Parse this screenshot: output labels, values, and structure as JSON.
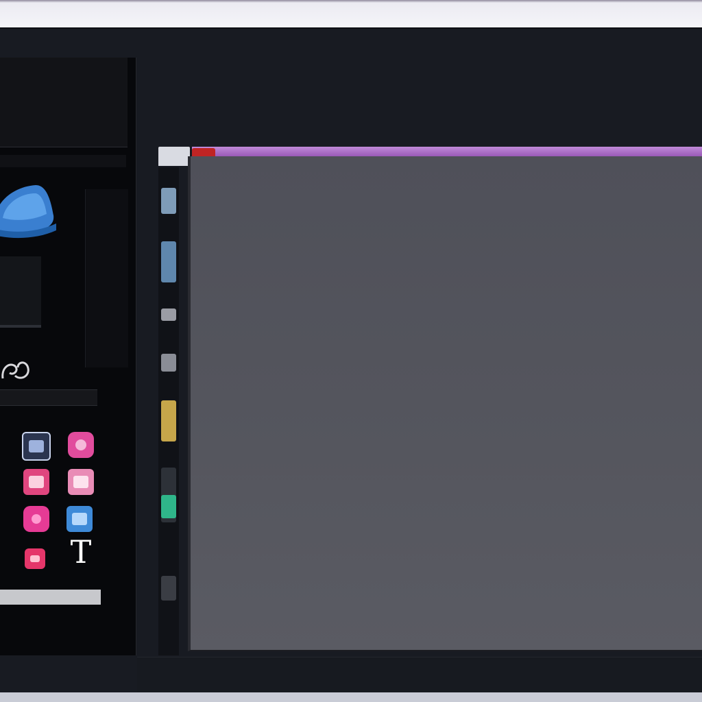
{
  "window": {
    "title": ""
  },
  "left_panel": {
    "header_left": "",
    "header_right": "",
    "header_caption": "",
    "status_text": "",
    "tools": [
      {
        "name": "tool-image",
        "color": "#9eb2dd"
      },
      {
        "name": "tool-circle",
        "color": "#e14c9d"
      },
      {
        "name": "tool-frame",
        "color": "#e0467f"
      },
      {
        "name": "tool-panel",
        "color": "#e98cb6"
      },
      {
        "name": "tool-record",
        "color": "#e63b95"
      },
      {
        "name": "tool-grid",
        "color": "#3e8ad8"
      },
      {
        "name": "tool-small",
        "color": "#e5366a"
      }
    ],
    "text_tool_glyph": "T"
  },
  "panel_label": "",
  "canvas": {
    "title": "",
    "subtitle": "",
    "note_line_1": "",
    "note_line_2": ""
  },
  "colors": {
    "accent_purple": "#b074cf",
    "accent_red": "#c02424",
    "canvas_bg": "#53545c"
  }
}
